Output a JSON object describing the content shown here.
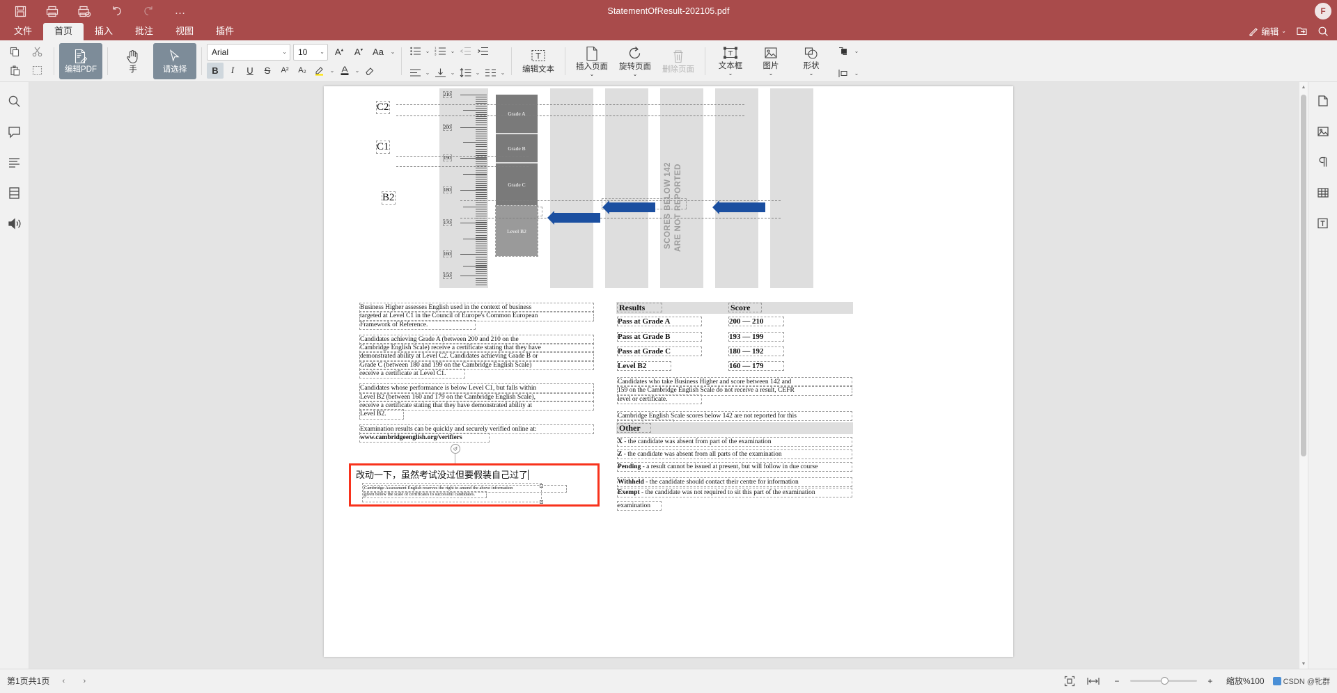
{
  "titlebar": {
    "document_title": "StatementOfResult-202105.pdf",
    "quick_access": [
      {
        "name": "save-icon",
        "label": "保存"
      },
      {
        "name": "print-icon",
        "label": "打印"
      },
      {
        "name": "print-preview-icon",
        "label": "打印预览"
      },
      {
        "name": "undo-icon",
        "label": "撤销"
      },
      {
        "name": "redo-icon",
        "label": "恢复"
      },
      {
        "name": "more-icon",
        "label": "…"
      }
    ],
    "avatar_initial": "F"
  },
  "tabs": [
    {
      "label": "文件",
      "active": false
    },
    {
      "label": "首页",
      "active": true
    },
    {
      "label": "插入",
      "active": false
    },
    {
      "label": "批注",
      "active": false
    },
    {
      "label": "视图",
      "active": false
    },
    {
      "label": "插件",
      "active": false
    }
  ],
  "tabbar_right": {
    "edit_mode": "编辑",
    "export_icon": "export-icon",
    "search_icon": "search-icon"
  },
  "ribbon": {
    "clipboard": {
      "copy": "复制",
      "cut": "剪切",
      "paste": "粘贴",
      "select": "选择区域"
    },
    "edit_pdf": "编辑PDF",
    "hand": "手",
    "select_tool": "请选择",
    "font": {
      "family": "Arial",
      "size": "10",
      "grow": "A",
      "shrink": "A",
      "case": "Aa",
      "bold": "B",
      "italic": "I",
      "underline": "U",
      "strike": "S",
      "superscript": "A²",
      "subscript": "A₂",
      "highlight": "highlight-icon",
      "fontcolor": "font-color-icon",
      "clearfmt": "clear-format-icon"
    },
    "paragraph": {
      "bullets": "bullet-list-icon",
      "numbering": "numbered-list-icon",
      "outdent": "outdent-icon",
      "indent": "indent-icon",
      "align": "align-icon",
      "valign": "vertical-align-icon",
      "linespacing": "line-spacing-icon",
      "columns": "columns-icon"
    },
    "pages": [
      {
        "label": "编辑文本",
        "icon": "edit-text-icon",
        "disabled": false
      },
      {
        "label": "插入页面",
        "icon": "insert-page-icon",
        "disabled": false
      },
      {
        "label": "旋转页面",
        "icon": "rotate-page-icon",
        "disabled": false
      },
      {
        "label": "删除页面",
        "icon": "delete-page-icon",
        "disabled": true
      }
    ],
    "objects": [
      {
        "label": "文本框",
        "icon": "textbox-icon"
      },
      {
        "label": "图片",
        "icon": "picture-icon"
      },
      {
        "label": "形状",
        "icon": "shape-icon"
      }
    ],
    "arrange": {
      "order": "arrange-order-icon",
      "align": "arrange-align-icon"
    }
  },
  "left_rail": [
    {
      "name": "search-panel-icon"
    },
    {
      "name": "comment-panel-icon"
    },
    {
      "name": "outline-panel-icon"
    },
    {
      "name": "thumbnail-panel-icon"
    },
    {
      "name": "read-aloud-icon"
    }
  ],
  "right_rail": [
    {
      "name": "properties-icon"
    },
    {
      "name": "image-panel-icon"
    },
    {
      "name": "paragraph-mark-icon"
    },
    {
      "name": "table-panel-icon"
    },
    {
      "name": "text-style-icon"
    }
  ],
  "document": {
    "chart": {
      "cefr_levels": [
        "C2",
        "C1",
        "B2"
      ],
      "scale_ticks": [
        "210",
        "200",
        "190",
        "180",
        "170",
        "160",
        "150"
      ],
      "grade_bands": [
        "Grade A",
        "Grade B",
        "Grade C",
        "Level B2"
      ],
      "vertical_note_line1": "SCORES BELOW 142",
      "vertical_note_line2": "ARE NOT REPORTED"
    },
    "left_paragraphs": [
      [
        "Business Higher assesses English used in the context of business",
        "targeted at Level C1 in the Council of Europe's Common European",
        "Framework of Reference."
      ],
      [
        "Candidates achieving Grade A (between 200 and 210 on the",
        "Cambridge English Scale) receive a certificate stating that they have",
        "demonstrated ability at Level C2. Candidates achieving Grade B or",
        "Grade C (between 180 and 199 on the Cambridge English Scale)",
        "receive a certificate at Level C1."
      ],
      [
        "Candidates whose performance is below Level C1, but falls within",
        "Level B2 (between 160 and 179 on the Cambridge English Scale),",
        "receive a certificate stating that they have demonstrated ability at",
        "Level B2."
      ],
      [
        "Examination results can be quickly and securely verified online at:",
        "www.cambridgeenglish.org/verifiers"
      ]
    ],
    "disclaimer": [
      "Cambridge Assessment English reserves the right to amend the above information",
      "given below the scale of certificates to successful candidates."
    ],
    "results_table": {
      "headers": [
        "Results",
        "Score"
      ],
      "rows": [
        {
          "result": "Pass at Grade A",
          "score": "200 — 210"
        },
        {
          "result": "Pass at Grade B",
          "score": "193 — 199"
        },
        {
          "result": "Pass at Grade C",
          "score": "180 — 192"
        },
        {
          "result": "Level B2",
          "score": "160 — 179"
        }
      ]
    },
    "right_notes": [
      [
        "Candidates who take Business Higher and score between 142 and",
        "159 on the Cambridge English Scale do not receive a result, CEFR",
        "level or certificate."
      ],
      [
        "Cambridge English Scale scores below 142 are not reported for this",
        "examination."
      ]
    ],
    "other_table": {
      "header": "Other",
      "rows": [
        {
          "code": "X",
          "desc": "- the candidate was absent from part of the examination"
        },
        {
          "code": "Z",
          "desc": "- the candidate was absent from all parts of the examination"
        },
        {
          "code": "Pending",
          "desc": "- a result cannot be issued at present, but will follow in due course"
        },
        {
          "code": "Withheld",
          "desc": "- the candidate should contact their centre for information"
        },
        {
          "code": "Exempt",
          "desc": "- the candidate was not required to sit this part of the examination"
        }
      ]
    },
    "editing_textbox": {
      "text": "改动一下，虽然考试没过但要假装自己过了"
    }
  },
  "status_bar": {
    "page_info": "第1页共1页",
    "prev_page": "‹",
    "next_page": "›",
    "fit_page_icon": "fit-page-icon",
    "fit_width_icon": "fit-width-icon",
    "zoom_out": "−",
    "zoom_in": "+",
    "zoom_label": "缩放%100",
    "watermark": "CSDN @牝群"
  }
}
